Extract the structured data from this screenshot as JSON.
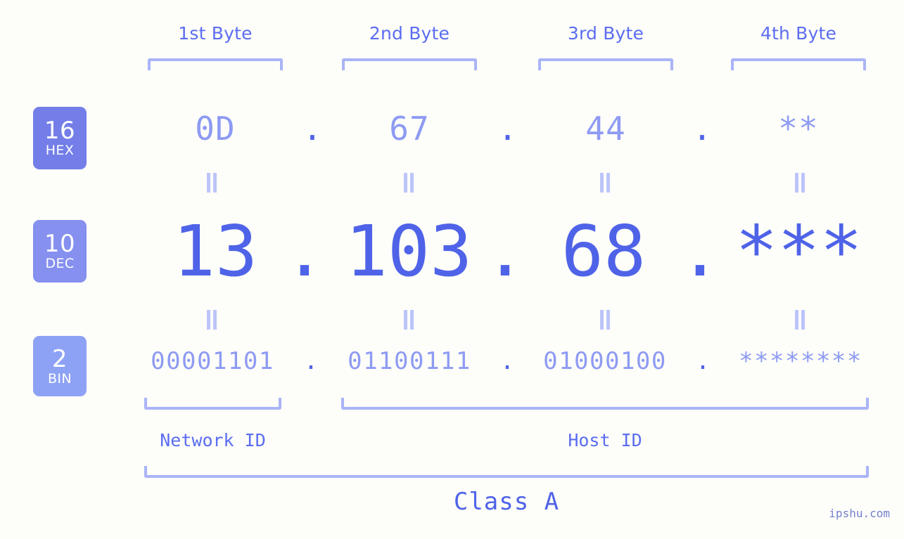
{
  "background": "#fdfdfa",
  "accent": "#4f63e8",
  "accent_light": "#8e9bf2",
  "bracket_color": "#aab4f7",
  "byte_headers": [
    {
      "label": "1st Byte"
    },
    {
      "label": "2nd Byte"
    },
    {
      "label": "3rd Byte"
    },
    {
      "label": "4th Byte"
    }
  ],
  "bases": [
    {
      "number": "16",
      "name": "HEX",
      "color": "#737ee8"
    },
    {
      "number": "10",
      "name": "DEC",
      "color": "#8590ef"
    },
    {
      "number": "2",
      "name": "BIN",
      "color": "#8ea2f5"
    }
  ],
  "rows": {
    "hex": {
      "base_number": "16",
      "base_name": "HEX",
      "values": [
        "0D",
        "67",
        "44",
        "**"
      ],
      "separator": "."
    },
    "dec": {
      "base_number": "10",
      "base_name": "DEC",
      "values": [
        "13",
        "103",
        "68",
        "***"
      ],
      "separator": "."
    },
    "bin": {
      "base_number": "2",
      "base_name": "BIN",
      "values": [
        "00001101",
        "01100111",
        "01000100",
        "********"
      ],
      "separator": "."
    }
  },
  "equality_marks": {
    "symbol": "=",
    "count_per_gap": 4
  },
  "sections": [
    {
      "label": "Network ID"
    },
    {
      "label": "Host ID"
    }
  ],
  "class": {
    "label": "Class A"
  },
  "watermark": {
    "text": "ipshu.com"
  }
}
